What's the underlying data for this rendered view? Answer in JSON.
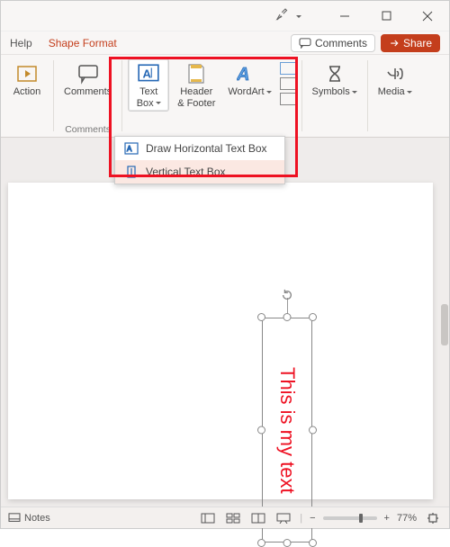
{
  "titlebar": {
    "autosave": ""
  },
  "tabs": {
    "help": "Help",
    "shape_format": "Shape Format",
    "comments_btn": "Comments",
    "share_btn": "Share"
  },
  "ribbon": {
    "action": "Action",
    "comments": "Comments",
    "text_box": "Text\nBox",
    "header_footer": "Header\n& Footer",
    "wordart": "WordArt",
    "symbols": "Symbols",
    "media": "Media",
    "group_comments": "Comments"
  },
  "dropdown": {
    "horizontal": "Draw Horizontal Text Box",
    "vertical": "Vertical Text Box"
  },
  "shape": {
    "text": "This is my text"
  },
  "status": {
    "notes": "Notes",
    "zoom_pct": "77%"
  }
}
